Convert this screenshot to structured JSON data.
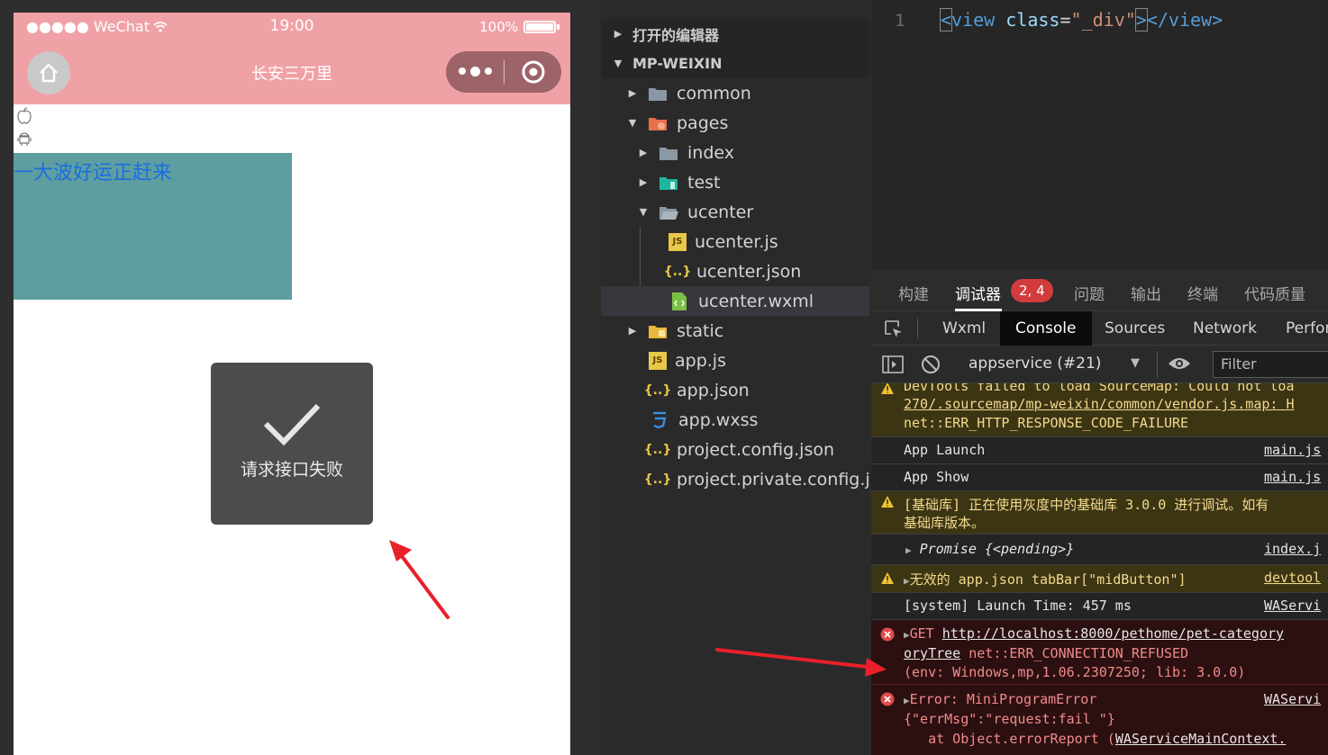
{
  "simulator": {
    "status_left": "●●●●● WeChat",
    "status_time": "19:00",
    "status_battery": "100%",
    "nav_title": "长安三万里",
    "teal_text": "一大波好运正赶来",
    "toast_text": "请求接口失败"
  },
  "explorer": {
    "open_editors": "打开的编辑器",
    "project": "MP-WEIXIN",
    "items": [
      {
        "label": "common"
      },
      {
        "label": "pages"
      },
      {
        "label": "index"
      },
      {
        "label": "test"
      },
      {
        "label": "ucenter"
      },
      {
        "label": "ucenter.js"
      },
      {
        "label": "ucenter.json"
      },
      {
        "label": "ucenter.wxml"
      },
      {
        "label": "static"
      },
      {
        "label": "app.js"
      },
      {
        "label": "app.json"
      },
      {
        "label": "app.wxss"
      },
      {
        "label": "project.config.json"
      },
      {
        "label": "project.private.config.js..."
      }
    ]
  },
  "editor": {
    "line_number": "1",
    "tag_open": "view",
    "attr": "class",
    "attr_value": "\"_div\"",
    "tag_close": "view"
  },
  "panel": {
    "tabs": [
      "构建",
      "调试器",
      "问题",
      "输出",
      "终端",
      "代码质量"
    ],
    "badge": "2, 4",
    "devtools_tabs": [
      "Wxml",
      "Console",
      "Sources",
      "Network",
      "Perfor"
    ],
    "context": "appservice (#21)",
    "filter_placeholder": "Filter"
  },
  "console": {
    "l1a": "DevTools failed to load SourceMap: Could not loa",
    "l1b": "270/.sourcemap/mp-weixin/common/vendor.js.map: H",
    "l1c": "net::ERR_HTTP_RESPONSE_CODE_FAILURE",
    "l2": "App Launch",
    "l2src": "main.js",
    "l3": "App Show",
    "l3src": "main.js",
    "l4a": "[基础库] 正在使用灰度中的基础库 3.0.0 进行调试。如有",
    "l4b": "基础库版本。",
    "l5": "Promise {<pending>}",
    "l5src": "index.j",
    "l6": "无效的 app.json tabBar[\"midButton\"]",
    "l6src": "devtool",
    "l7": "[system] Launch Time: 457 ms",
    "l7src": "WAServi",
    "l8method": "GET",
    "l8url": "http://localhost:8000/pethome/pet-category",
    "l8b": "oryTree",
    "l8err": " net::ERR_CONNECTION_REFUSED",
    "l8c": "(env: Windows,mp,1.06.2307250; lib: 3.0.0)",
    "l9a": "Error: MiniProgramError",
    "l9src": "WAServi",
    "l9b": "{\"errMsg\":\"request:fail \"}",
    "l9c_prefix": "   at Object.errorReport (",
    "l9c_link": "WAServiceMainContext."
  },
  "colors": {
    "nav_pink": "#f0a1a6",
    "teal": "#5f9ea0",
    "error_red": "#d23c3c",
    "arrow_red": "#e8202a"
  }
}
